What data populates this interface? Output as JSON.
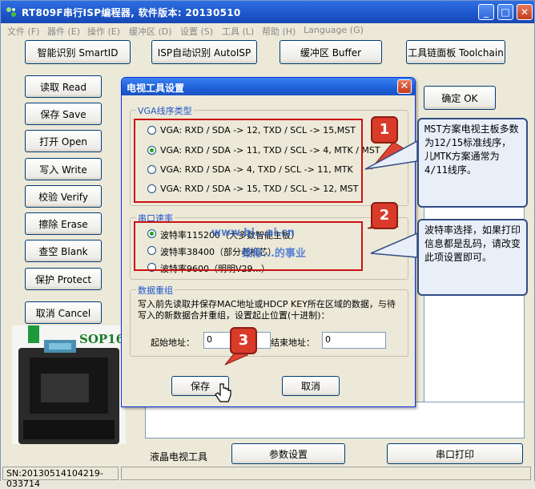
{
  "window": {
    "title": "RT809F串行ISP编程器, 软件版本: 20130510",
    "min_glyph": "_",
    "max_glyph": "□",
    "close_glyph": "✕"
  },
  "menu": [
    "文件 (F)",
    "器件 (E)",
    "操作 (E)",
    "缓冲区 (D)",
    "设置 (S)",
    "工具 (L)",
    "帮助 (H)",
    "Language (G)"
  ],
  "toolbar": {
    "smart_id": "智能识别 SmartID",
    "isp_auto": "ISP自动识别 AutoISP",
    "buffer": "缓冲区 Buffer",
    "toolchain": "工具链面板 Toolchain"
  },
  "side_buttons": {
    "read": "读取 Read",
    "save": "保存 Save",
    "open": "打开 Open",
    "write": "写入 Write",
    "verify": "校验 Verify",
    "erase": "擦除 Erase",
    "blank": "查空 Blank",
    "protect": "保护 Protect",
    "cancel": "取消 Cancel"
  },
  "ok_button": "确定 OK",
  "chip_label": "SOP16",
  "bottom_bar": {
    "lcd_tool": "液晶电视工具",
    "params": "参数设置",
    "serial_print": "串口打印"
  },
  "status": {
    "sn": "SN:20130514104219-033714"
  },
  "dialog": {
    "title": "电视工具设置",
    "vga_group": "VGA线序类型",
    "vga_options": [
      "VGA: RXD / SDA -> 12, TXD / SCL -> 15,MST",
      "VGA: RXD / SDA -> 11, TXD / SCL ->  4, MTK / MST",
      "VGA: RXD / SDA ->  4, TXD / SCL -> 11, MTK",
      "VGA: RXD / SDA -> 15, TXD / SCL -> 12, MST"
    ],
    "vga_selected": 1,
    "baud_group": "串口速率",
    "baud_options": [
      "波特率115200（大多数智能主板）",
      "波特率38400（部分老机芯）",
      "波特率9600（明明V29...）"
    ],
    "baud_selected": 0,
    "watermark_1": "www.bj...ai.cn",
    "watermark_2": "维修...的事业",
    "reorg_group": "数据重组",
    "reorg_text": "写入前先读取并保存MAC地址或HDCP KEY所在区域的数据，与待写入的新数据合并重组，设置起止位置(十进制)：",
    "start_label": "起始地址：",
    "start_value": "0",
    "end_label": "结束地址：",
    "end_value": "0",
    "save": "保存",
    "cancel": "取消"
  },
  "annotations": {
    "n1": "1",
    "n2": "2",
    "n3": "3",
    "callout1": "MST方案电视主板多数为12/15标准线序，儿MTK方案通常为4/11线序。",
    "callout2": "波特率选择，如果打印信息都是乱码，请改变此项设置即可。"
  }
}
